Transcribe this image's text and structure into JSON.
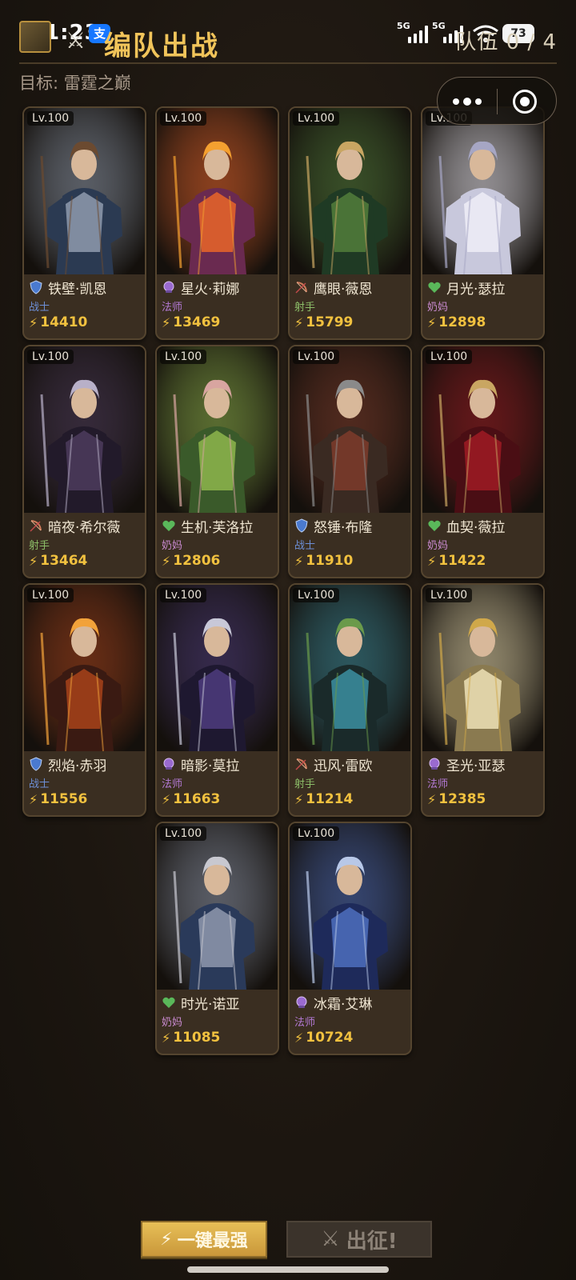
{
  "status_bar": {
    "time": "1:23",
    "alipay_label": "支",
    "network_1": "5G",
    "network_2": "5G",
    "battery": "73"
  },
  "header": {
    "title": "编队出战",
    "team_count": "队伍 0 / 4",
    "target": "目标: 雷霆之巅"
  },
  "role_colors": {
    "战士": "#6d8fd6",
    "法师": "#b47ad6",
    "射手": "#8cbd68",
    "奶妈": "#c98ad0"
  },
  "heroes": [
    {
      "level": "Lv.100",
      "name": "铁壁·凯恩",
      "role": "战士",
      "power": "14410",
      "icon": "shield-icon",
      "palette": [
        "#2b3a52",
        "#8a96a8",
        "#6b4a30"
      ]
    },
    {
      "level": "Lv.100",
      "name": "星火·莉娜",
      "role": "法师",
      "power": "13469",
      "icon": "orb-icon",
      "palette": [
        "#6a2a50",
        "#e2622a",
        "#f4a030"
      ]
    },
    {
      "level": "Lv.100",
      "name": "鹰眼·薇恩",
      "role": "射手",
      "power": "15799",
      "icon": "bow-icon",
      "palette": [
        "#1f3a24",
        "#4f7a3a",
        "#c9a662"
      ]
    },
    {
      "level": "Lv.100",
      "name": "月光·瑟拉",
      "role": "奶妈",
      "power": "12898",
      "icon": "heart-icon",
      "palette": [
        "#c8c8dc",
        "#ecebf5",
        "#a6a6c4"
      ]
    },
    {
      "level": "Lv.100",
      "name": "暗夜·希尔薇",
      "role": "射手",
      "power": "13464",
      "icon": "bow-icon",
      "palette": [
        "#221a2a",
        "#4a3a5a",
        "#b8b0c8"
      ]
    },
    {
      "level": "Lv.100",
      "name": "生机·芙洛拉",
      "role": "奶妈",
      "power": "12806",
      "icon": "heart-icon",
      "palette": [
        "#3a5a2a",
        "#8ab04a",
        "#d8a5a0"
      ]
    },
    {
      "level": "Lv.100",
      "name": "怒锤·布隆",
      "role": "战士",
      "power": "11910",
      "icon": "shield-icon",
      "palette": [
        "#3a2a22",
        "#7a3a2a",
        "#8a8a8a"
      ]
    },
    {
      "level": "Lv.100",
      "name": "血契·薇拉",
      "role": "奶妈",
      "power": "11422",
      "icon": "heart-icon",
      "palette": [
        "#4a0e14",
        "#9a1a22",
        "#c9a662"
      ]
    },
    {
      "level": "Lv.100",
      "name": "烈焰·赤羽",
      "role": "战士",
      "power": "11556",
      "icon": "shield-icon",
      "palette": [
        "#3a1a12",
        "#a2401a",
        "#f2a23a"
      ]
    },
    {
      "level": "Lv.100",
      "name": "暗影·莫拉",
      "role": "法师",
      "power": "11663",
      "icon": "orb-icon",
      "palette": [
        "#1e1830",
        "#4a3a7a",
        "#c8c8d8"
      ]
    },
    {
      "level": "Lv.100",
      "name": "迅风·雷欧",
      "role": "射手",
      "power": "11214",
      "icon": "bow-icon",
      "palette": [
        "#1a2a2a",
        "#3a8a9a",
        "#6a9a4a"
      ]
    },
    {
      "level": "Lv.100",
      "name": "圣光·亚瑟",
      "role": "法师",
      "power": "12385",
      "icon": "orb-icon",
      "palette": [
        "#8a7a50",
        "#e8dcb0",
        "#d0a84a"
      ]
    },
    {
      "level": "Lv.100",
      "name": "时光·诺亚",
      "role": "奶妈",
      "power": "11085",
      "icon": "heart-icon",
      "palette": [
        "#2a3a5a",
        "#8a94a8",
        "#c8c8d0"
      ]
    },
    {
      "level": "Lv.100",
      "name": "冰霜·艾琳",
      "role": "法师",
      "power": "10724",
      "icon": "orb-icon",
      "palette": [
        "#1e2a5a",
        "#4a6ab8",
        "#b8c8e8"
      ]
    }
  ],
  "actions": {
    "strongest_label": "一键最强",
    "deploy_label": "出征!"
  }
}
